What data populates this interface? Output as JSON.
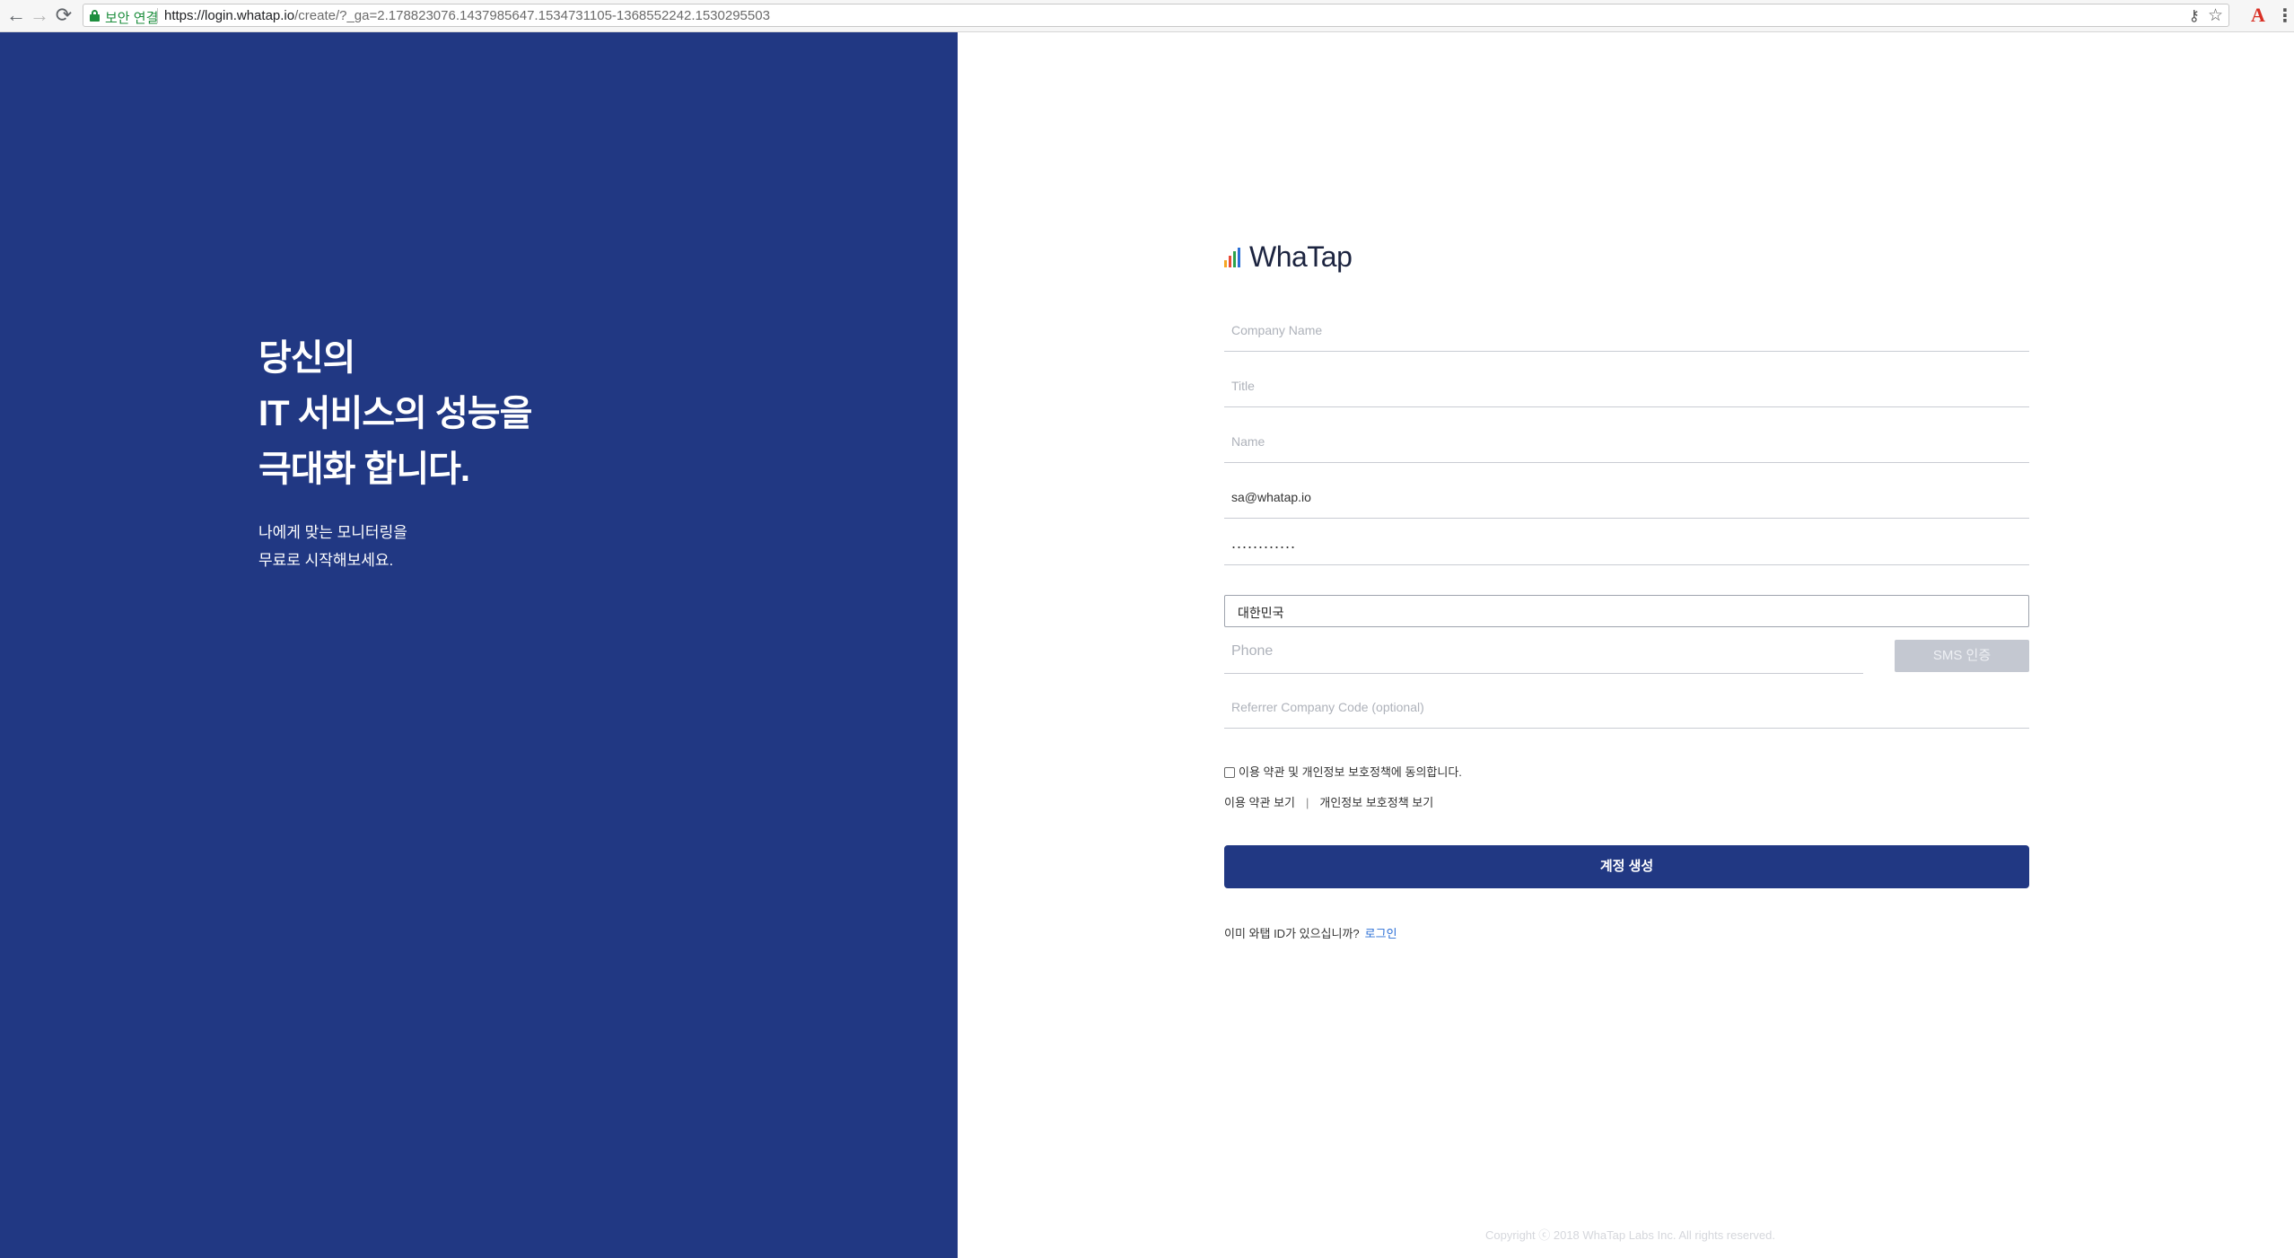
{
  "browser": {
    "secure_label": "보안 연결",
    "url_host": "https://login.whatap.io",
    "url_rest": "/create/?_ga=2.178823076.1437985647.1534731105-1368552242.1530295503",
    "extension_label": "A",
    "icons": {
      "back": "←",
      "forward": "→",
      "reload": "⟳",
      "key": "⚷",
      "star": "☆",
      "menu": "⋮"
    }
  },
  "hero": {
    "headline_line1": "당신의",
    "headline_line2": "IT 서비스의 성능을",
    "headline_line3": "극대화 합니다.",
    "sub_line1": "나에게 맞는 모니터링을",
    "sub_line2": "무료로 시작해보세요."
  },
  "logo": {
    "text": "WhaTap",
    "bar_colors": [
      "#f5a623",
      "#e94b35",
      "#2ba24c",
      "#2b6fd6"
    ]
  },
  "form": {
    "company_placeholder": "Company Name",
    "title_placeholder": "Title",
    "name_placeholder": "Name",
    "email_value": "sa@whatap.io",
    "password_value": "............",
    "country_value": "대한민국",
    "phone_placeholder": "Phone",
    "sms_label": "SMS 인증",
    "referrer_placeholder": "Referrer Company Code (optional)",
    "agree_label": "이용 약관 및 개인정보 보호정책에 동의합니다.",
    "terms_link": "이용 약관 보기",
    "link_separator": "|",
    "privacy_link": "개인정보 보호정책 보기",
    "submit_label": "계정 생성",
    "existing_text": "이미 와탭 ID가 있으십니까?",
    "login_link": "로그인"
  },
  "footer": {
    "copyright": "Copyright ⓒ 2018 WhaTap Labs Inc. All rights reserved."
  },
  "colors": {
    "brand_navy": "#213883",
    "link_blue": "#2b6fd6",
    "secure_green": "#1e8e3e",
    "sms_disabled": "#c4c8d1"
  }
}
